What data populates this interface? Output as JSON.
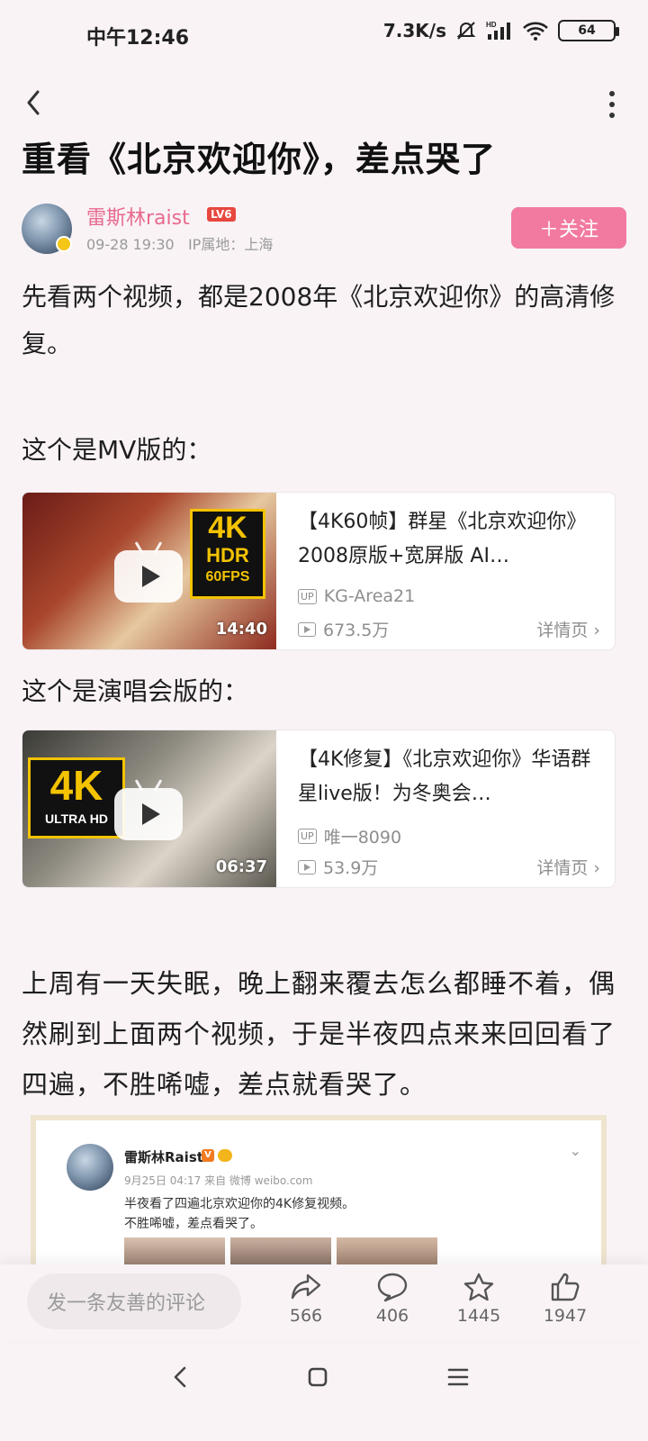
{
  "status": {
    "time": "中午12:46",
    "speed": "7.3K/s",
    "battery": "64"
  },
  "article": {
    "title": "重看《北京欢迎你》，差点哭了",
    "author": {
      "name": "雷斯林raist",
      "level": "LV6",
      "date": "09-28 19:30",
      "ip": "IP属地：上海",
      "follow_label": "＋关注"
    },
    "intro": "先看两个视频，都是2008年《北京欢迎你》的高清修复。",
    "label_mv": "这个是MV版的：",
    "label_concert": "这个是演唱会版的：",
    "body": "上周有一天失眠，晚上翻来覆去怎么都睡不着，偶然刷到上面两个视频，于是半夜四点来来回回看了四遍，不胜唏嘘，差点就看哭了。"
  },
  "videos": [
    {
      "title": "【4K60帧】群星《北京欢迎你》2008原版+宽屏版 AI…",
      "up_tag": "UP",
      "uploader": "KG-Area21",
      "views": "673.5万",
      "duration": "14:40",
      "detail": "详情页 ›",
      "badge_main": "4K",
      "badge_line2": "HDR",
      "badge_line3": "60FPS"
    },
    {
      "title": "【4K修复】《北京欢迎你》华语群星live版！为冬奥会…",
      "up_tag": "UP",
      "uploader": "唯一8090",
      "views": "53.9万",
      "duration": "06:37",
      "detail": "详情页 ›",
      "badge_main": "4K",
      "badge_line2": "ULTRA HD"
    }
  ],
  "embed": {
    "name": "雷斯林Raist",
    "v": "V",
    "meta": "9月25日 04:17 来自 微博 weibo.com",
    "line1": "半夜看了四遍北京欢迎你的4K修复视频。",
    "line2": "不胜唏嘘，差点看哭了。",
    "chevron": "⌄"
  },
  "bottom": {
    "comment_placeholder": "发一条友善的评论",
    "share_count": "566",
    "comment_count": "406",
    "fav_count": "1445",
    "like_count": "1947"
  },
  "icons": {
    "back": "back-arrow-icon",
    "more": "more-vertical-icon",
    "share": "share-icon",
    "comment": "comment-bubble-icon",
    "favorite": "star-icon",
    "like": "thumbs-up-icon"
  },
  "colors": {
    "accent": "#f27aa0",
    "author_name": "#e86a8e",
    "background": "#f9f3f6"
  }
}
